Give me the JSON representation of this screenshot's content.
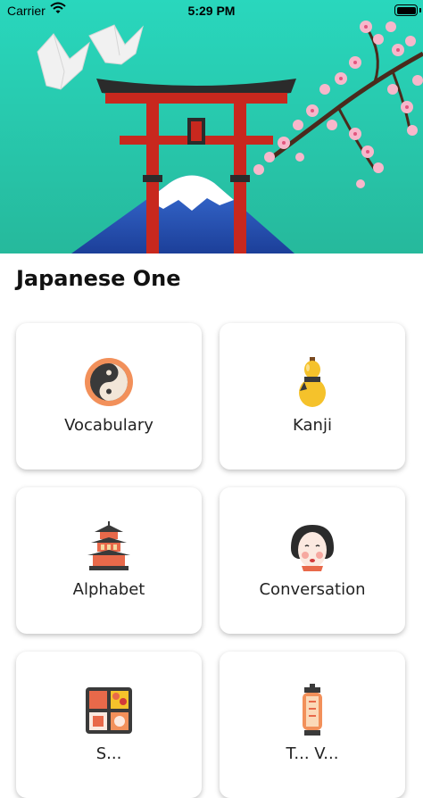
{
  "status_bar": {
    "carrier": "Carrier",
    "time": "5:29 PM"
  },
  "app": {
    "title": "Japanese One"
  },
  "categories": [
    {
      "label": "Vocabulary",
      "icon": "yin-yang-icon"
    },
    {
      "label": "Kanji",
      "icon": "gourd-icon"
    },
    {
      "label": "Alphabet",
      "icon": "pagoda-icon"
    },
    {
      "label": "Conversation",
      "icon": "geisha-mask-icon"
    },
    {
      "label": "S...",
      "icon": "bento-box-icon"
    },
    {
      "label": "T... V...",
      "icon": "lantern-icon"
    }
  ],
  "colors": {
    "hero_top": "#1fd9b8",
    "hero_bottom": "#2ec7a6",
    "torii_red": "#c8281e",
    "accent": "#000000"
  }
}
